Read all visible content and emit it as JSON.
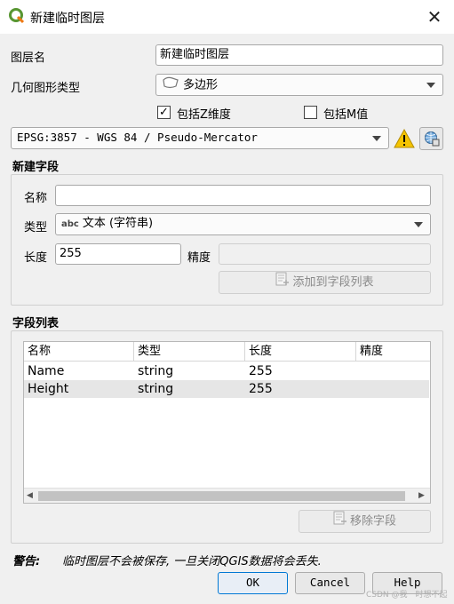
{
  "window": {
    "title": "新建临时图层"
  },
  "form": {
    "layer_name_label": "图层名",
    "layer_name_value": "新建临时图层",
    "geometry_type_label": "几何图形类型",
    "geometry_type_value": "多边形",
    "include_z_label": "包括Z维度",
    "include_z_checked": true,
    "include_m_label": "包括M值",
    "include_m_checked": false,
    "crs_value": "EPSG:3857 - WGS 84 / Pseudo-Mercator"
  },
  "new_field": {
    "group_title": "新建字段",
    "name_label": "名称",
    "name_value": "",
    "type_label": "类型",
    "type_prefix": "abc",
    "type_value": "文本 (字符串)",
    "length_label": "长度",
    "length_value": "255",
    "precision_label": "精度",
    "precision_value": "",
    "add_button": "添加到字段列表"
  },
  "field_list": {
    "group_title": "字段列表",
    "columns": [
      "名称",
      "类型",
      "长度",
      "精度"
    ],
    "rows": [
      [
        "Name",
        "string",
        "255",
        ""
      ],
      [
        "Height",
        "string",
        "255",
        ""
      ]
    ],
    "remove_button": "移除字段"
  },
  "warning": {
    "label": "警告:",
    "text": "临时图层不会被保存, 一旦关闭QGIS数据将会丢失."
  },
  "buttons": {
    "ok": "OK",
    "cancel": "Cancel",
    "help": "Help"
  },
  "watermark": "CSDN @我一时想不起"
}
